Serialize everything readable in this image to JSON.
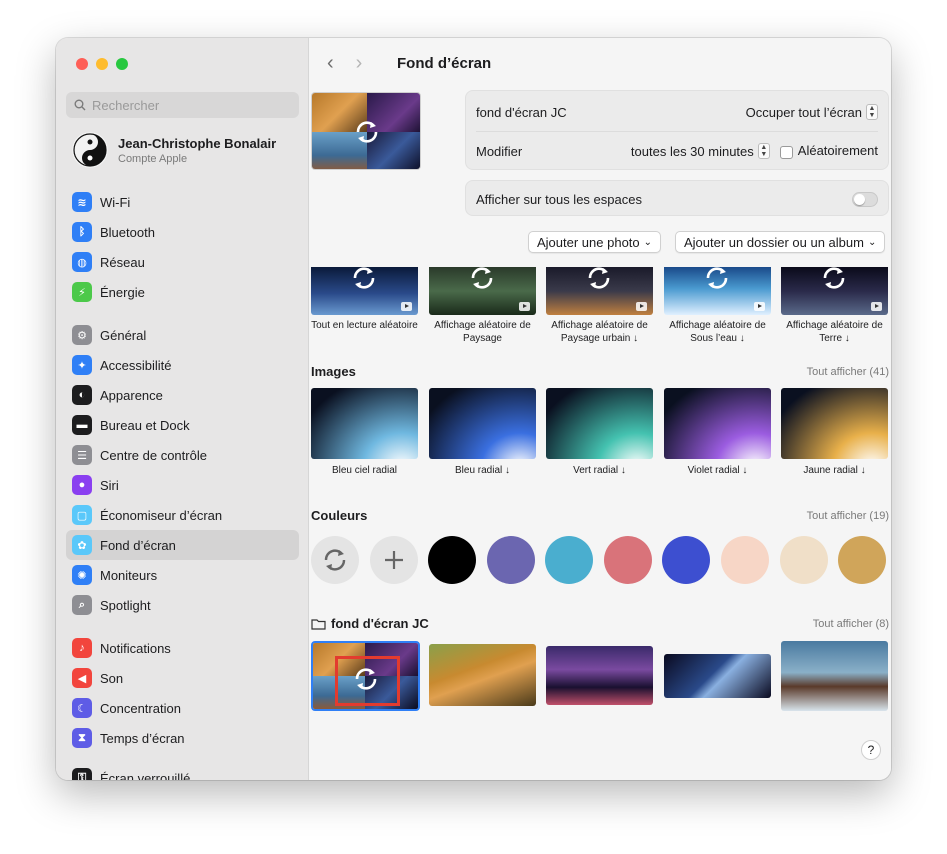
{
  "search": {
    "placeholder": "Rechercher"
  },
  "account": {
    "name": "Jean-Christophe Bonalair",
    "subtitle": "Compte Apple"
  },
  "sidebar": {
    "items": [
      {
        "label": "Wi-Fi",
        "icon": "wifi-icon",
        "color": "#2f7ff6"
      },
      {
        "label": "Bluetooth",
        "icon": "bluetooth-icon",
        "color": "#2f7ff6"
      },
      {
        "label": "Réseau",
        "icon": "globe-icon",
        "color": "#2f7ff6"
      },
      {
        "label": "Énergie",
        "icon": "battery-icon",
        "color": "#4cc94a"
      },
      {
        "label": "Général",
        "icon": "gear-icon",
        "color": "#8e8e93"
      },
      {
        "label": "Accessibilité",
        "icon": "accessibility-icon",
        "color": "#2f7ff6"
      },
      {
        "label": "Apparence",
        "icon": "appearance-icon",
        "color": "#1c1c1e"
      },
      {
        "label": "Bureau et Dock",
        "icon": "dock-icon",
        "color": "#1c1c1e"
      },
      {
        "label": "Centre de contrôle",
        "icon": "control-center-icon",
        "color": "#8e8e93"
      },
      {
        "label": "Siri",
        "icon": "siri-icon",
        "color": "#8a3ff0"
      },
      {
        "label": "Économiseur d’écran",
        "icon": "screensaver-icon",
        "color": "#5ac8fa"
      },
      {
        "label": "Fond d’écran",
        "icon": "wallpaper-icon",
        "color": "#5ac8fa"
      },
      {
        "label": "Moniteurs",
        "icon": "display-icon",
        "color": "#2f7ff6"
      },
      {
        "label": "Spotlight",
        "icon": "spotlight-icon",
        "color": "#8e8e93"
      },
      {
        "label": "Notifications",
        "icon": "bell-icon",
        "color": "#f2453d"
      },
      {
        "label": "Son",
        "icon": "speaker-icon",
        "color": "#f2453d"
      },
      {
        "label": "Concentration",
        "icon": "moon-icon",
        "color": "#5e5ce6"
      },
      {
        "label": "Temps d’écran",
        "icon": "hourglass-icon",
        "color": "#5e5ce6"
      },
      {
        "label": "Écran verrouillé",
        "icon": "lock-icon",
        "color": "#1c1c1e"
      }
    ]
  },
  "header": {
    "title": "Fond d’écran"
  },
  "settings": {
    "wallpaper_name": "fond d'écran JC",
    "fill_mode": "Occuper tout l’écran",
    "modify_label": "Modifier",
    "interval": "toutes les 30 minutes",
    "random_label": "Aléatoirement",
    "all_spaces_label": "Afficher sur tous les espaces"
  },
  "buttons": {
    "add_photo": "Ajouter une photo",
    "add_folder": "Ajouter un dossier ou un album"
  },
  "shuffle_row": [
    {
      "label": "Tout en lecture aléatoire"
    },
    {
      "label": "Affichage aléatoire de Paysage"
    },
    {
      "label": "Affichage aléatoire de Paysage urbain ↓"
    },
    {
      "label": "Affichage aléatoire de Sous l’eau ↓"
    },
    {
      "label": "Affichage aléatoire de Terre ↓"
    }
  ],
  "images": {
    "title": "Images",
    "show_all": "Tout afficher (41)",
    "items": [
      {
        "label": "Bleu ciel radial",
        "color": "#6fb8e0"
      },
      {
        "label": "Bleu radial ↓",
        "color": "#3a6fe0"
      },
      {
        "label": "Vert radial ↓",
        "color": "#44c2b0"
      },
      {
        "label": "Violet radial ↓",
        "color": "#9b5ce0"
      },
      {
        "label": "Jaune radial ↓",
        "color": "#e8b04a"
      }
    ]
  },
  "colors": {
    "title": "Couleurs",
    "show_all": "Tout afficher (19)",
    "swatches": [
      "#000000",
      "#6b66b0",
      "#4aaecf",
      "#d9737a",
      "#3d4fd0",
      "#f7d6c6",
      "#f0dfc8",
      "#d0a55a"
    ]
  },
  "folder": {
    "title": "fond d'écran JC",
    "show_all": "Tout afficher (8)"
  },
  "help": "?"
}
